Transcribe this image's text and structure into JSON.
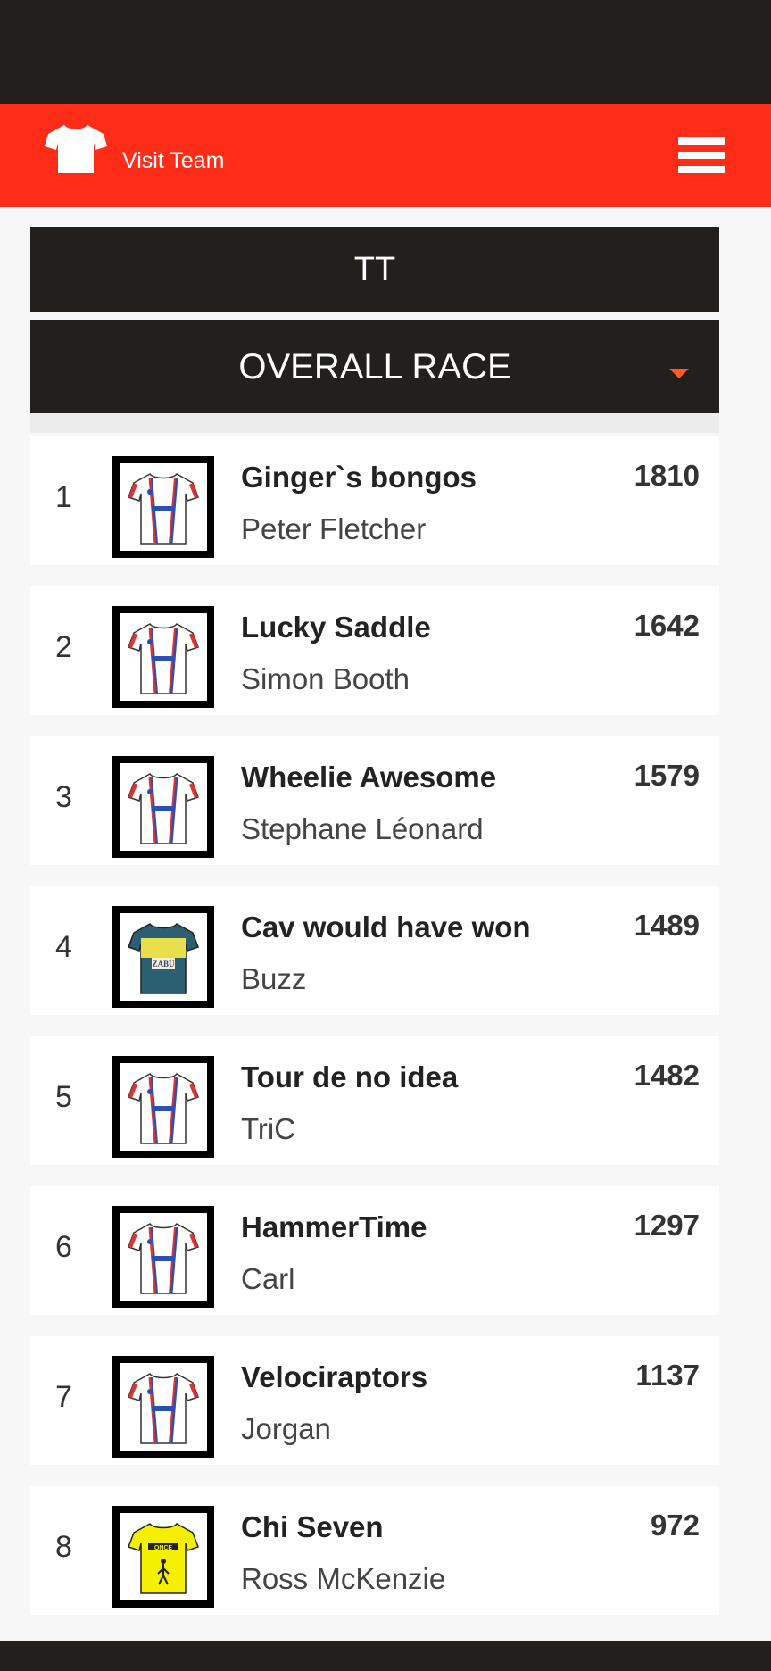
{
  "header": {
    "visit_team_label": "Visit Team"
  },
  "tabs": {
    "selected": "TT"
  },
  "race_select": {
    "selected": "OVERALL RACE"
  },
  "standings": [
    {
      "rank": "1",
      "team": "Ginger`s bongos",
      "manager": "Peter Fletcher",
      "points": "1810",
      "jersey": "white-blue-red"
    },
    {
      "rank": "2",
      "team": "Lucky Saddle",
      "manager": "Simon Booth",
      "points": "1642",
      "jersey": "white-blue-red"
    },
    {
      "rank": "3",
      "team": "Wheelie Awesome",
      "manager": "Stephane Léonard",
      "points": "1579",
      "jersey": "white-blue-red"
    },
    {
      "rank": "4",
      "team": "Cav would have won",
      "manager": "Buzz",
      "points": "1489",
      "jersey": "teal-yellow"
    },
    {
      "rank": "5",
      "team": "Tour de no idea",
      "manager": "TriC",
      "points": "1482",
      "jersey": "white-blue-red"
    },
    {
      "rank": "6",
      "team": "HammerTime",
      "manager": "Carl",
      "points": "1297",
      "jersey": "white-blue-red"
    },
    {
      "rank": "7",
      "team": "Velociraptors",
      "manager": "Jorgan",
      "points": "1137",
      "jersey": "white-blue-red"
    },
    {
      "rank": "8",
      "team": "Chi Seven",
      "manager": "Ross McKenzie",
      "points": "972",
      "jersey": "yellow-once"
    }
  ],
  "colors": {
    "brand_red": "#ff2d17",
    "dark": "#221f1d",
    "accent_orange": "#ff5a1f"
  }
}
